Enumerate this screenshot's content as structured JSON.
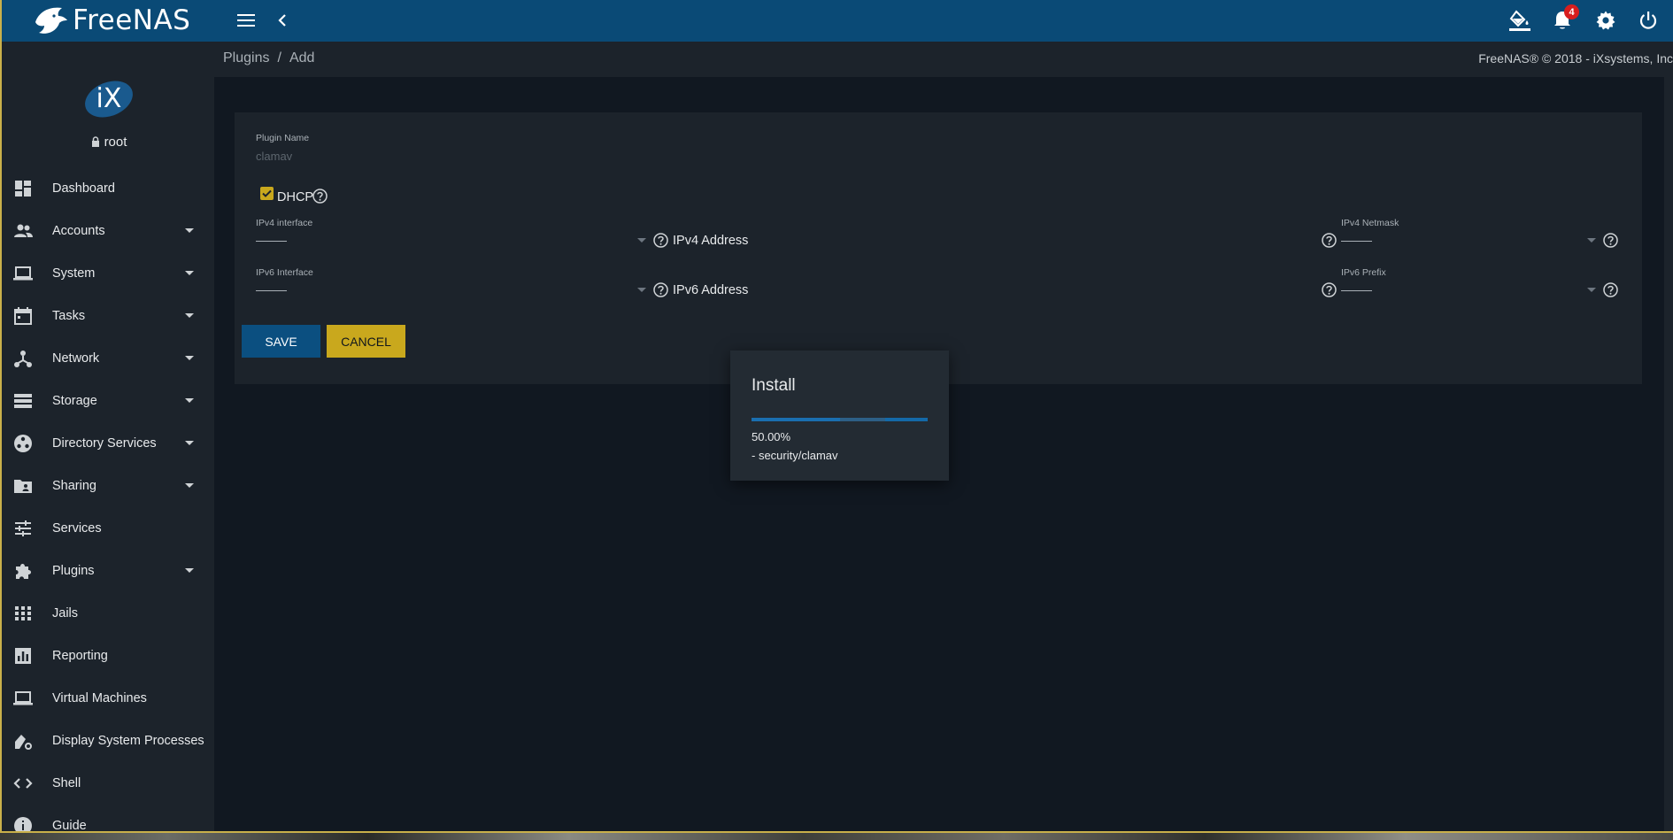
{
  "app": {
    "logo_text": "FreeNAS",
    "notification_count": "4"
  },
  "user": {
    "name": "root"
  },
  "sidebar": {
    "items": [
      {
        "label": "Dashboard",
        "icon": "dashboard-icon",
        "expandable": false
      },
      {
        "label": "Accounts",
        "icon": "people-icon",
        "expandable": true
      },
      {
        "label": "System",
        "icon": "laptop-icon",
        "expandable": true
      },
      {
        "label": "Tasks",
        "icon": "calendar-icon",
        "expandable": true
      },
      {
        "label": "Network",
        "icon": "network-icon",
        "expandable": true
      },
      {
        "label": "Storage",
        "icon": "storage-icon",
        "expandable": true
      },
      {
        "label": "Directory Services",
        "icon": "directory-icon",
        "expandable": true
      },
      {
        "label": "Sharing",
        "icon": "folder-share-icon",
        "expandable": true
      },
      {
        "label": "Services",
        "icon": "tune-icon",
        "expandable": false
      },
      {
        "label": "Plugins",
        "icon": "puzzle-icon",
        "expandable": true
      },
      {
        "label": "Jails",
        "icon": "grid-icon",
        "expandable": false
      },
      {
        "label": "Reporting",
        "icon": "chart-icon",
        "expandable": false
      },
      {
        "label": "Virtual Machines",
        "icon": "laptop-icon",
        "expandable": false
      },
      {
        "label": "Display System Processes",
        "icon": "processes-icon",
        "expandable": false
      },
      {
        "label": "Shell",
        "icon": "code-icon",
        "expandable": false
      },
      {
        "label": "Guide",
        "icon": "info-icon",
        "expandable": false
      }
    ]
  },
  "breadcrumb": {
    "parent": "Plugins",
    "separator": "/",
    "current": "Add"
  },
  "copyright": "FreeNAS® © 2018 - iXsystems, Inc",
  "form": {
    "plugin_name_label": "Plugin Name",
    "plugin_name_value": "clamav",
    "dhcp_label": "DHCP",
    "dhcp_checked": true,
    "ipv4_interface_label": "IPv4 interface",
    "ipv4_address_label": "IPv4 Address",
    "ipv4_netmask_label": "IPv4 Netmask",
    "ipv6_interface_label": "IPv6 Interface",
    "ipv6_address_label": "IPv6 Address",
    "ipv6_prefix_label": "IPv6 Prefix",
    "save_label": "SAVE",
    "cancel_label": "CANCEL"
  },
  "dialog": {
    "title": "Install",
    "progress_percent": 50,
    "progress_text": "50.00%",
    "description": "- security/clamav"
  },
  "colors": {
    "topbar": "#0a4a76",
    "sidebar": "#1c232b",
    "background": "#111821",
    "primary_button": "#0b4f80",
    "accent_button": "#c9a81d",
    "badge": "#d81e1e"
  }
}
